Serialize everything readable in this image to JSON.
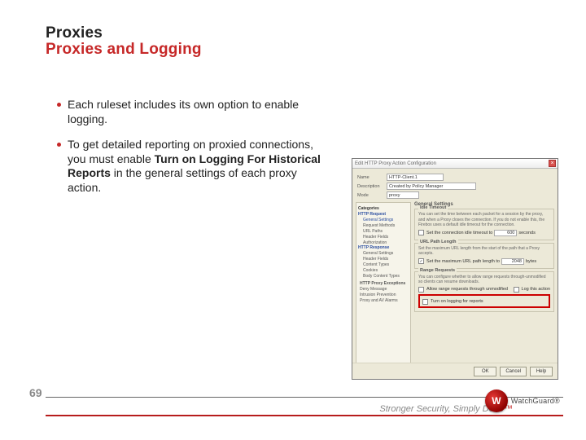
{
  "title": {
    "line1": "Proxies",
    "line2": "Proxies and Logging"
  },
  "bullets": [
    {
      "text_a": "Each ruleset includes its own option to enable logging."
    },
    {
      "text_a": "To get detailed reporting on proxied connections, you must enable ",
      "bold": "Turn on Logging For Historical Reports",
      "text_b": " in the general settings of each proxy action."
    }
  ],
  "dialog": {
    "title": "Edit HTTP Proxy Action Configuration",
    "close": "×",
    "name_label": "Name",
    "name_value": "HTTP-Client.1",
    "desc_label": "Description",
    "desc_value": "Created by Policy Manager",
    "mode_label": "Mode",
    "mode_value": "proxy",
    "categories_label": "Categories",
    "left_tree": {
      "root1": "HTTP Request",
      "root1_items": [
        "General Settings",
        "Request Methods",
        "URL Paths",
        "Header Fields",
        "Authorization"
      ],
      "root2": "HTTP Response",
      "root2_items": [
        "General Settings",
        "Header Fields",
        "Content Types",
        "Cookies",
        "Body Content Types"
      ],
      "extras": [
        "HTTP Proxy Exceptions",
        "Deny Message",
        "Intrusion Prevention",
        "Proxy and AV Alarms"
      ]
    },
    "gs_legend": "General Settings",
    "gs_sub1": "Idle Timeout",
    "gs_desc": "You can set the time between each packet for a session by the proxy, and when a Proxy closes the connection. If you do not enable this, the Firebox uses a default idle timeout for the connection.",
    "gs_ck1": "Set the connection idle timeout to",
    "gs_ck1_val": "600",
    "gs_ck1_unit": "seconds",
    "url_legend": "URL Path Length",
    "url_desc": "Set the maximum URL length from the start of the path that a Proxy accepts.",
    "url_ck": "Set the maximum URL path length to",
    "url_val": "2048",
    "url_unit": "bytes",
    "range_legend": "Range Requests",
    "range_desc": "You can configure whether to allow range requests through-unmodified so clients can resume downloads.",
    "range_ck1": "Allow range requests through unmodified",
    "range_ck1_log": "Log this action",
    "range_ck2": "Turn on logging for reports",
    "buttons": {
      "ok": "OK",
      "cancel": "Cancel",
      "help": "Help"
    }
  },
  "footer": {
    "page": "69",
    "tagline_strong": "Stronger Security, Simply Done",
    "tagline_tm": "™",
    "logo_letter": "W",
    "logo_text": "WatchGuard®"
  }
}
